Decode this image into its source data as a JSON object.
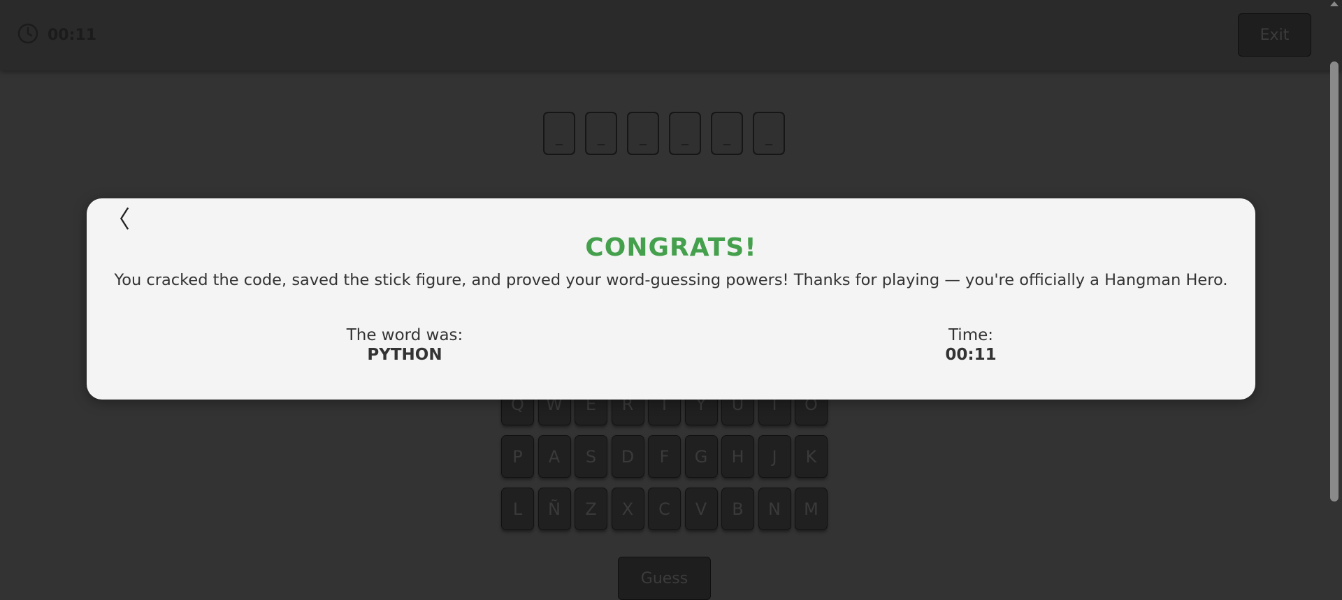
{
  "header": {
    "timer": "00:11",
    "exit_label": "Exit"
  },
  "word_slots": [
    "_",
    "_",
    "_",
    "_",
    "_",
    "_"
  ],
  "keyboard": {
    "rows": [
      [
        "Q",
        "W",
        "E",
        "R",
        "T",
        "Y",
        "U",
        "I",
        "O"
      ],
      [
        "P",
        "A",
        "S",
        "D",
        "F",
        "G",
        "H",
        "J",
        "K"
      ],
      [
        "L",
        "Ñ",
        "Z",
        "X",
        "C",
        "V",
        "B",
        "N",
        "M"
      ]
    ]
  },
  "guess_label": "Guess",
  "modal": {
    "back_glyph": "〈",
    "title": "CONGRATS!",
    "message": "You cracked the code, saved the stick figure, and proved your word-guessing powers! Thanks for playing — you're officially a Hangman Hero.",
    "word_label": "The word was:",
    "word_value": "PYTHON",
    "time_label": "Time:",
    "time_value": "00:11"
  },
  "colors": {
    "background": "#333333",
    "header": "#2a2a2a",
    "modal": "#f4f4f4",
    "title_green": "#45a04d",
    "key": "#202020"
  }
}
